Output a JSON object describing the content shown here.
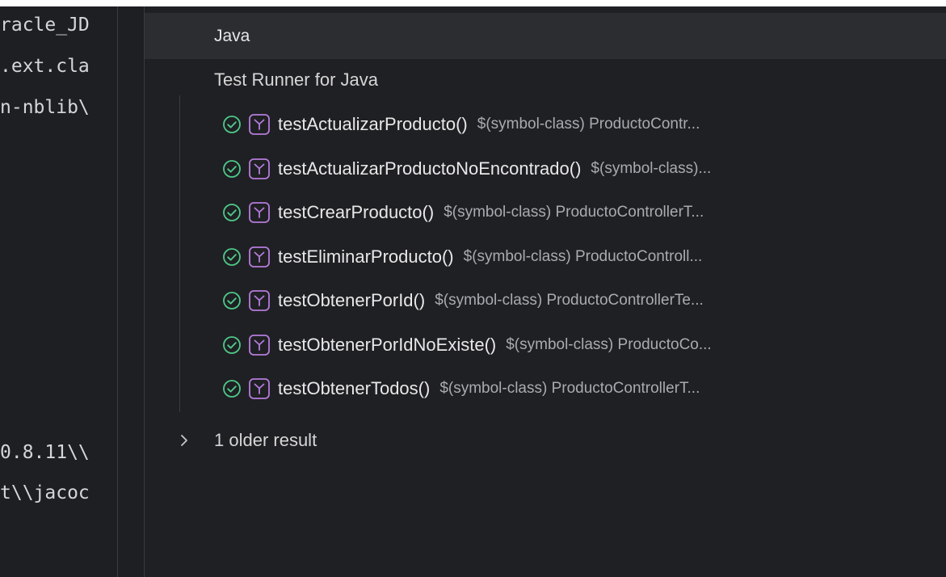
{
  "editor": {
    "lines": [
      "racle_JD",
      ".ext.cla",
      "n-nblib\\",
      "0.8.11\\\\",
      "t\\\\jacoc"
    ]
  },
  "panel": {
    "title": "Java",
    "group_label": "Test Runner for Java",
    "tests": [
      {
        "name": "testActualizarProducto()",
        "description": "$(symbol-class) ProductoContr...",
        "status": "passed"
      },
      {
        "name": "testActualizarProductoNoEncontrado()",
        "description": "$(symbol-class)...",
        "status": "passed"
      },
      {
        "name": "testCrearProducto()",
        "description": "$(symbol-class) ProductoControllerT...",
        "status": "passed"
      },
      {
        "name": "testEliminarProducto()",
        "description": "$(symbol-class) ProductoControll...",
        "status": "passed"
      },
      {
        "name": "testObtenerPorId()",
        "description": "$(symbol-class) ProductoControllerTe...",
        "status": "passed"
      },
      {
        "name": "testObtenerPorIdNoExiste()",
        "description": "$(symbol-class) ProductoCo...",
        "status": "passed"
      },
      {
        "name": "testObtenerTodos()",
        "description": "$(symbol-class) ProductoControllerT...",
        "status": "passed"
      }
    ],
    "older_results_label": "1 older result"
  },
  "colors": {
    "pass": "#4ec98a",
    "test_icon": "#b57cdc",
    "background": "#1e1f22",
    "header_bg": "#2b2d31"
  },
  "icons": {
    "status": "check-circle-icon",
    "test": "beaker-icon",
    "expand": "chevron-right-icon"
  }
}
